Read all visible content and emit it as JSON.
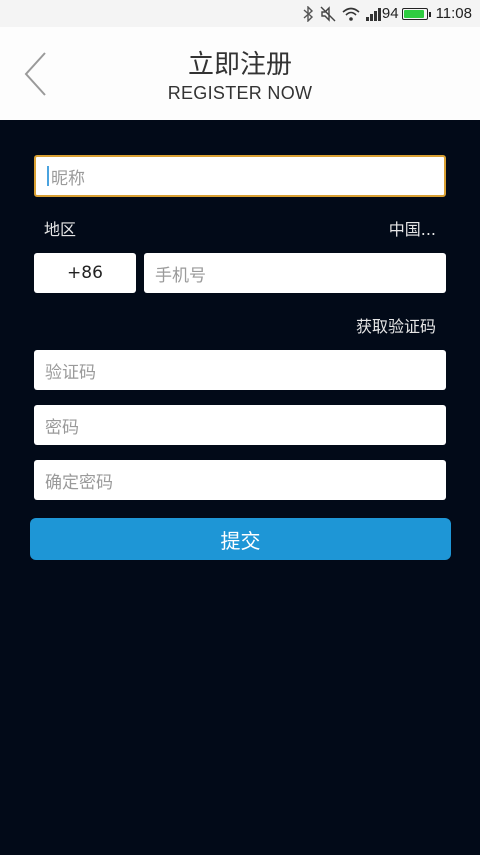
{
  "status_bar": {
    "battery_level": "94",
    "time": "11:08"
  },
  "header": {
    "title": "立即注册",
    "subtitle": "REGISTER NOW"
  },
  "form": {
    "nickname_placeholder": "昵称",
    "region_label": "地区",
    "region_value": "中国...",
    "country_code": "+86",
    "phone_placeholder": "手机号",
    "get_code_label": "获取验证码",
    "code_placeholder": "验证码",
    "password_placeholder": "密码",
    "confirm_password_placeholder": "确定密码",
    "submit_label": "提交"
  },
  "colors": {
    "background": "#020a18",
    "accent": "#1e96d6",
    "focus_border": "#d9a033"
  }
}
